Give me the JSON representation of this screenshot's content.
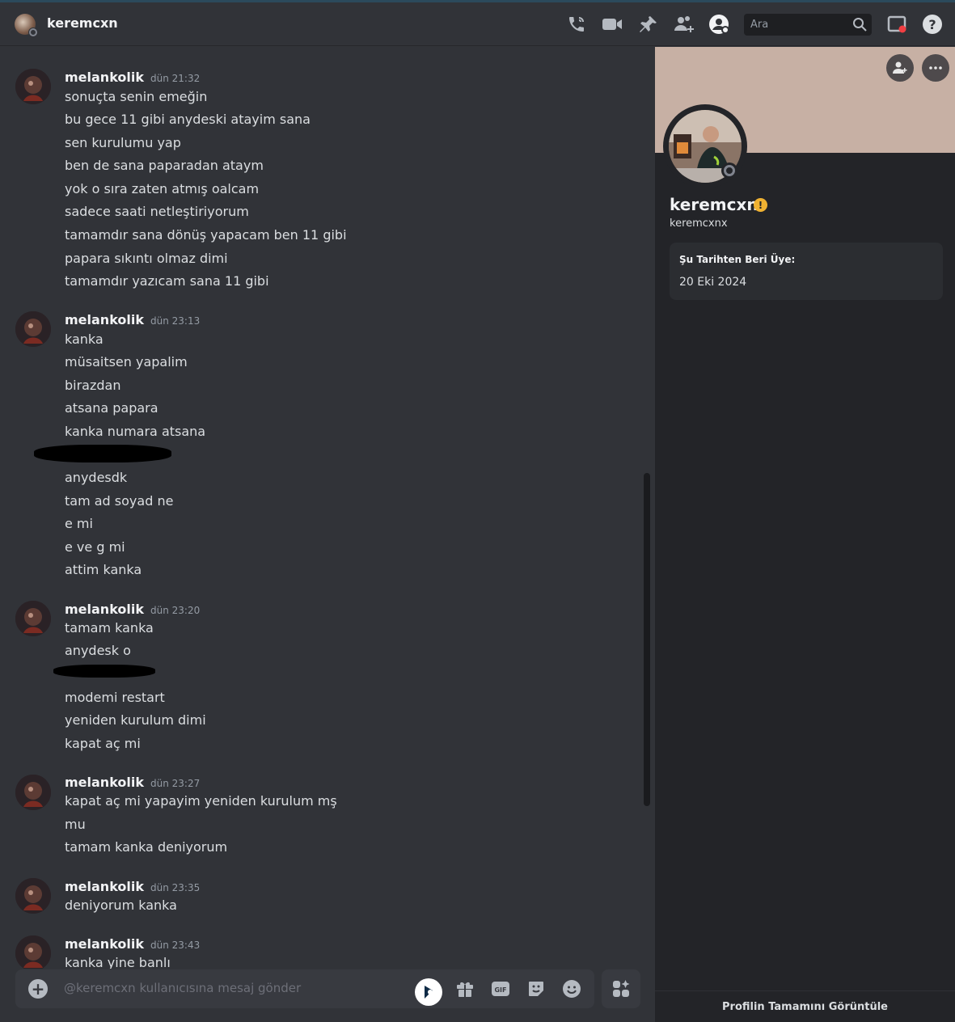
{
  "header": {
    "title": "keremcxn",
    "search_placeholder": "Ara",
    "icons": [
      "phone-call-icon",
      "video-call-icon",
      "pin-icon",
      "add-friend-icon",
      "user-profile-icon",
      "search-icon",
      "inbox-icon",
      "help-icon"
    ]
  },
  "messages": [
    {
      "author": "melankolik",
      "time": "dün 21:32",
      "lines": [
        "sonuçta senin emeğin",
        "bu gece 11 gibi anydeski atayim sana",
        "sen kurulumu yap",
        "ben de sana paparadan ataym",
        "yok o sıra zaten atmış oalcam",
        "sadece saati netleştiriyorum",
        "tamamdır sana dönüş yapacam ben 11 gibi",
        "papara sıkıntı olmaz dimi",
        "tamamdır yazıcam sana 11 gibi"
      ]
    },
    {
      "author": "melankolik",
      "time": "dün 23:13",
      "lines": [
        "kanka",
        "müsaitsen yapalim",
        "birazdan",
        "atsana papara",
        "kanka numara atsana",
        "anydesdk",
        "tam ad soyad ne",
        "e mi",
        "e ve g mi",
        "attim kanka"
      ]
    },
    {
      "author": "melankolik",
      "time": "dün 23:20",
      "lines": [
        "tamam kanka",
        "anydesk o",
        "modemi restart",
        "yeniden kurulum dimi",
        "kapat aç mi"
      ]
    },
    {
      "author": "melankolik",
      "time": "dün 23:27",
      "lines": [
        "kapat aç mi yapayim yeniden kurulum mş",
        "mu",
        "tamam kanka deniyorum"
      ]
    },
    {
      "author": "melankolik",
      "time": "dün 23:35",
      "lines": [
        "deniyorum kanka"
      ]
    },
    {
      "author": "melankolik",
      "time": "dün 23:43",
      "lines": [
        "kanka yine banlı"
      ]
    }
  ],
  "composer": {
    "placeholder": "@keremcxn kullanıcısına mesaj gönder",
    "gif_label": "GIF",
    "icons": [
      "add-attachment-icon",
      "translate-app-icon",
      "gift-icon",
      "gif-icon",
      "sticker-icon",
      "emoji-icon",
      "apps-icon"
    ]
  },
  "profile": {
    "display_name": "keremcxn",
    "username": "keremcxnx",
    "badge": "!",
    "member_since_label": "Şu Tarihten Beri Üye:",
    "member_since_value": "20 Eki 2024",
    "footer_link": "Profilin Tamamını Görüntüle",
    "banner_color": "#c7b0a4",
    "status": "offline"
  },
  "colors": {
    "background": "#313338",
    "panel": "#232428",
    "text": "#dbdee1",
    "muted": "#949ba4",
    "badge": "#f0b232"
  }
}
